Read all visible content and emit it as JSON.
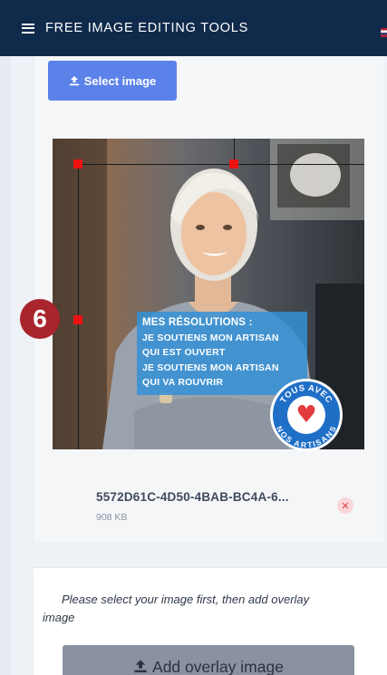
{
  "header": {
    "title": "FREE IMAGE EDITING TOOLS",
    "menu_icon": "hamburger-menu-icon",
    "flag_icon": "us-flag-icon"
  },
  "upload": {
    "select_label": "Select image",
    "select_icon": "upload-icon"
  },
  "image_preview": {
    "overlay_text": {
      "heading": "MES RÉSOLUTIONS :",
      "lines": [
        "JE SOUTIENS MON ARTISAN",
        "QUI EST OUVERT",
        "JE SOUTIENS MON ARTISAN",
        "QUI VA ROUVRIR"
      ]
    },
    "badge": {
      "top_text": "TOUS AVEC",
      "bottom_text": "NOS ARTISANS",
      "icon": "heart-icon"
    }
  },
  "step_marker": "6",
  "file": {
    "name": "5572D61C-4D50-4BAB-BC4A-6...",
    "size": "908 KB",
    "remove_icon": "close-icon"
  },
  "overlay": {
    "hint": "Please select your image first, then add overlay image",
    "button_label": "Add overlay image",
    "button_icon": "upload-icon"
  },
  "colors": {
    "header_bg": "#102a4c",
    "primary_button": "#5b82e8",
    "disabled_button": "#8a92a2",
    "step_badge": "#a9252b",
    "crop_handle": "#ee1111",
    "overlay_text_bg": "#3490d6",
    "remove_button_bg": "#fbd6da"
  }
}
